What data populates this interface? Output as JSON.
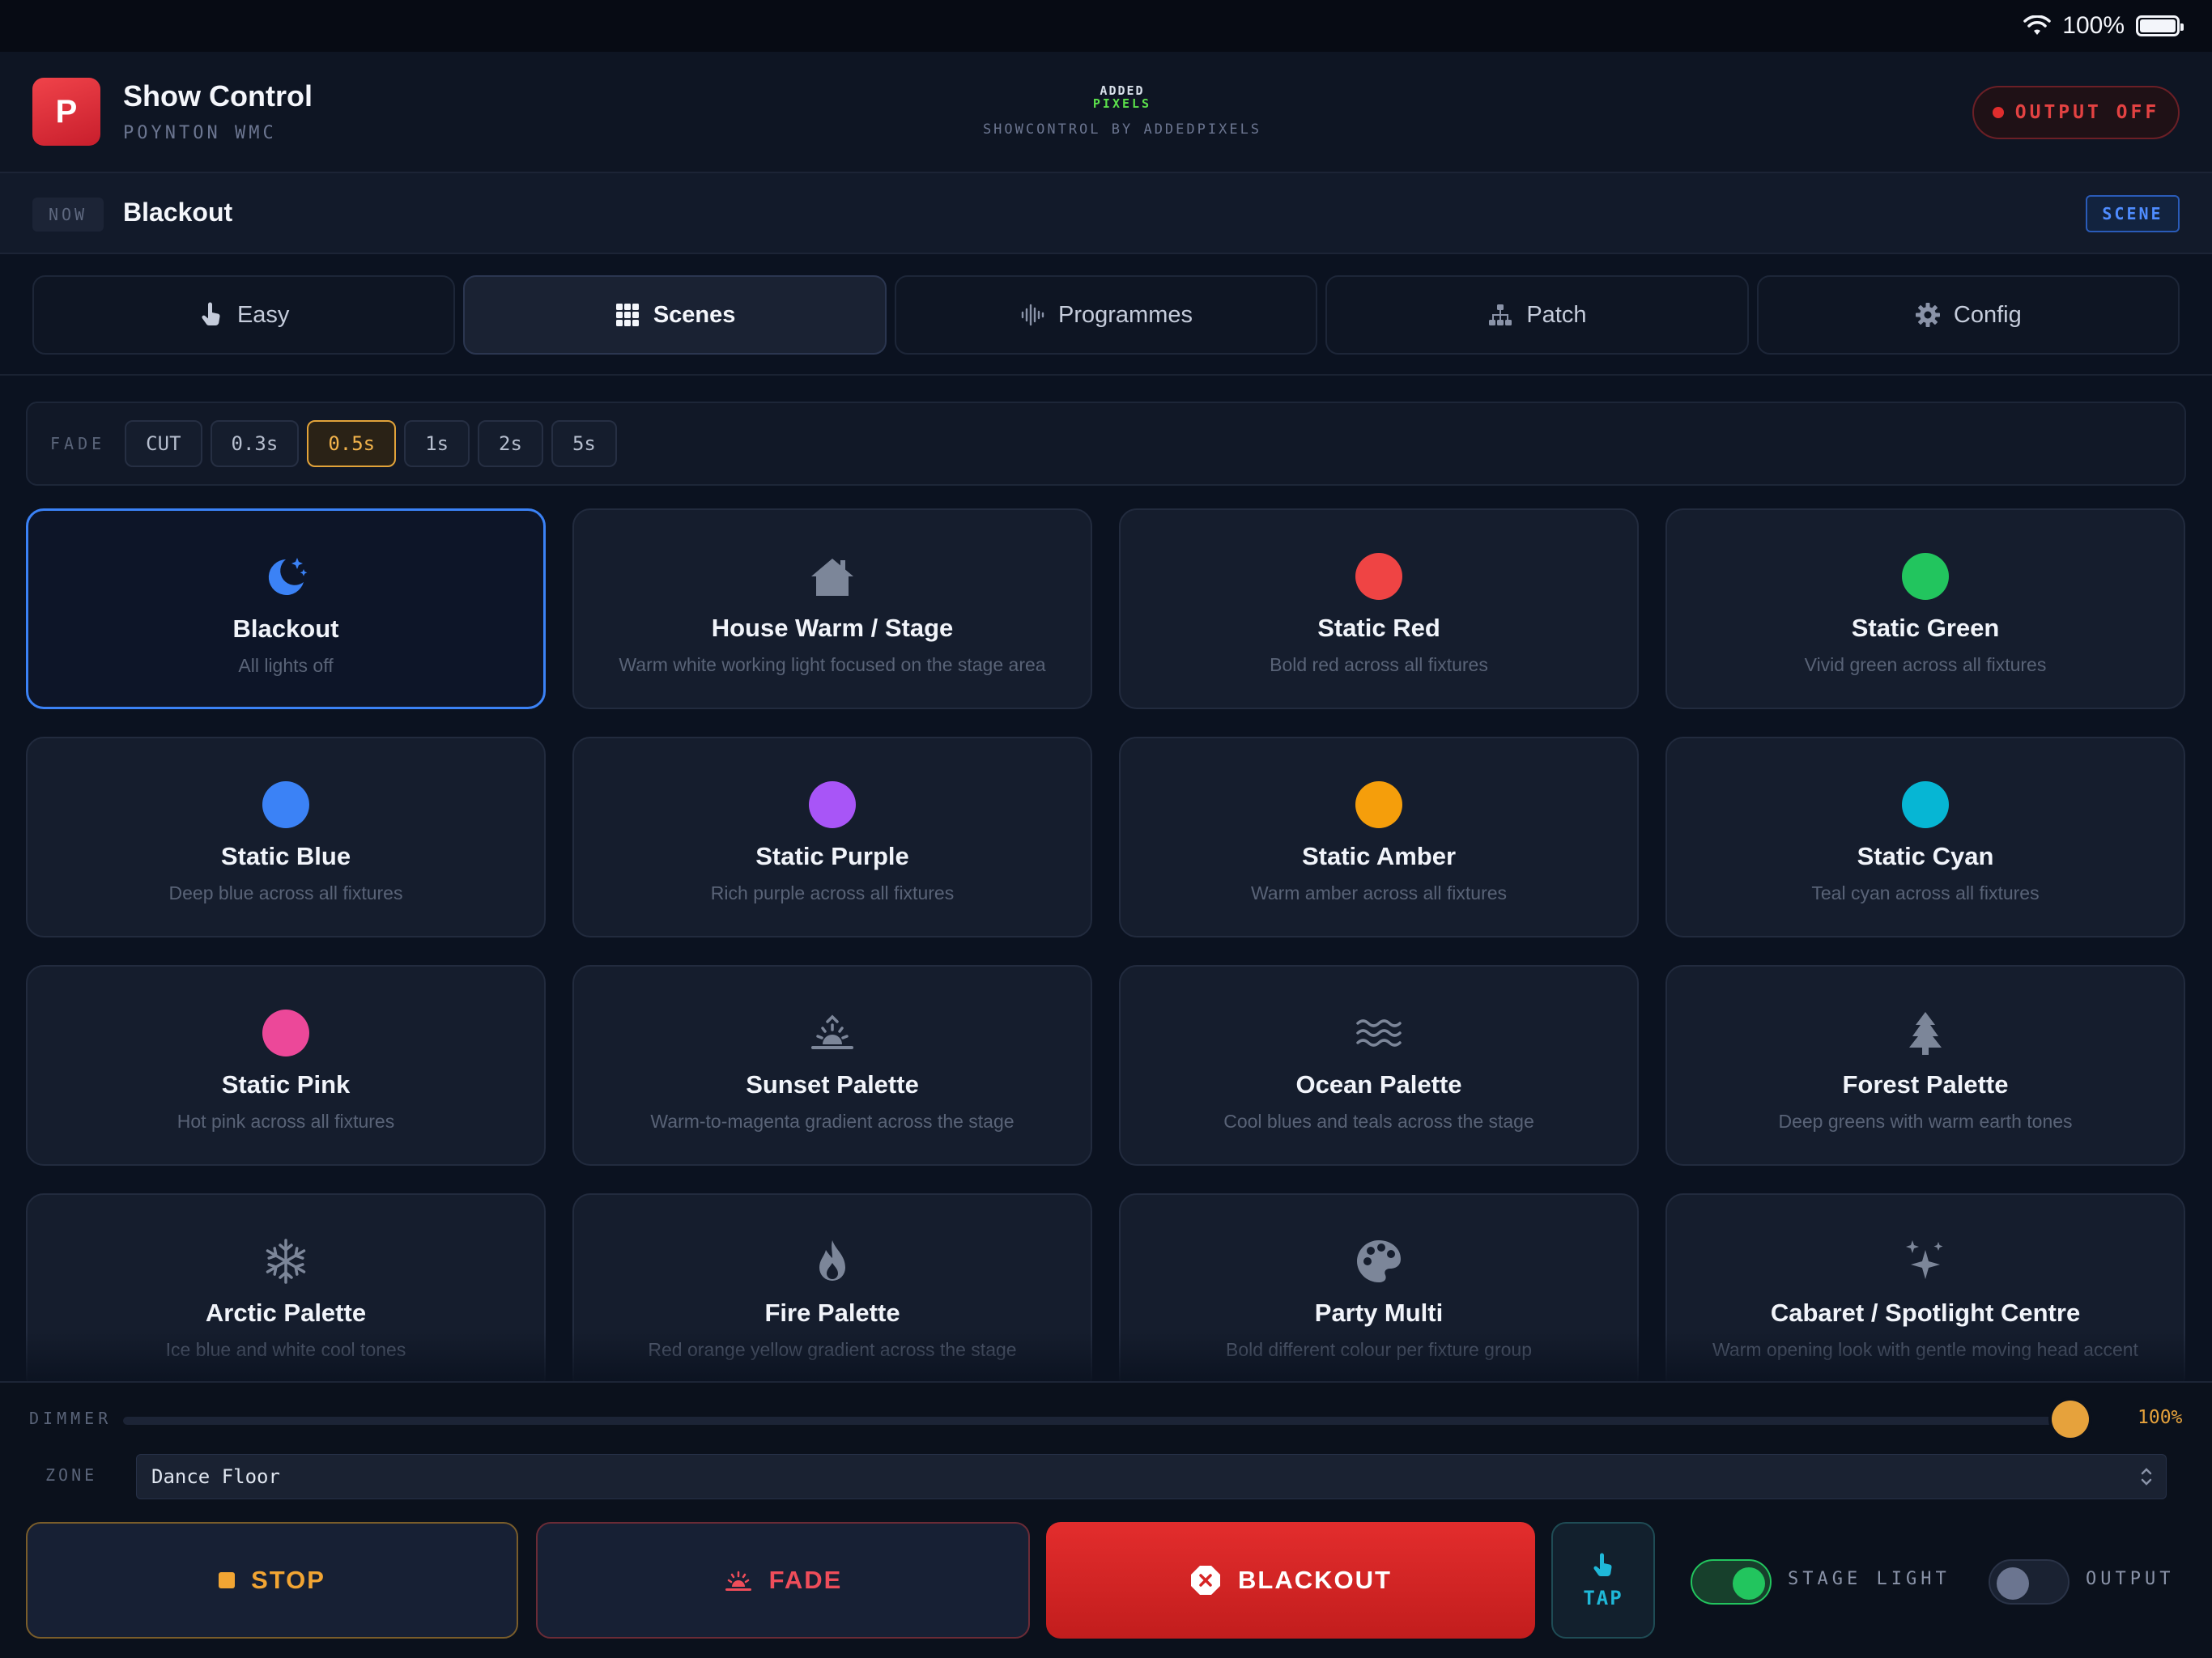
{
  "status_bar": {
    "battery": "100%"
  },
  "header": {
    "logo_letter": "P",
    "title": "Show Control",
    "subtitle": "POYNTON WMC",
    "brand_top": "ADDED",
    "brand_bottom": "PIXELS",
    "brand_tagline": "SHOWCONTROL BY ADDEDPIXELS",
    "output_button": "OUTPUT OFF"
  },
  "now_bar": {
    "tag": "NOW",
    "current_scene": "Blackout",
    "mode_tag": "SCENE"
  },
  "tabs": [
    {
      "label": "Easy",
      "icon": "hand-pointer-icon"
    },
    {
      "label": "Scenes",
      "icon": "grid-icon",
      "active": true
    },
    {
      "label": "Programmes",
      "icon": "waveform-icon"
    },
    {
      "label": "Patch",
      "icon": "network-icon"
    },
    {
      "label": "Config",
      "icon": "gear-icon"
    }
  ],
  "fade": {
    "label": "FADE",
    "options": [
      "CUT",
      "0.3s",
      "0.5s",
      "1s",
      "2s",
      "5s"
    ],
    "selected": "0.5s"
  },
  "scenes": [
    {
      "name": "Blackout",
      "desc": "All lights off",
      "icon": "moon-stars-icon",
      "active": true
    },
    {
      "name": "House Warm / Stage",
      "desc": "Warm white working light focused on the stage area",
      "icon": "house-icon"
    },
    {
      "name": "Static Red",
      "desc": "Bold red across all fixtures",
      "color": "#ef4444"
    },
    {
      "name": "Static Green",
      "desc": "Vivid green across all fixtures",
      "color": "#22c55e"
    },
    {
      "name": "Static Blue",
      "desc": "Deep blue across all fixtures",
      "color": "#3b82f6"
    },
    {
      "name": "Static Purple",
      "desc": "Rich purple across all fixtures",
      "color": "#a855f7"
    },
    {
      "name": "Static Amber",
      "desc": "Warm amber across all fixtures",
      "color": "#f59e0b"
    },
    {
      "name": "Static Cyan",
      "desc": "Teal cyan across all fixtures",
      "color": "#06b6d4"
    },
    {
      "name": "Static Pink",
      "desc": "Hot pink across all fixtures",
      "color": "#ec4899"
    },
    {
      "name": "Sunset Palette",
      "desc": "Warm-to-magenta gradient across the stage",
      "icon": "sunset-icon"
    },
    {
      "name": "Ocean Palette",
      "desc": "Cool blues and teals across the stage",
      "icon": "waves-icon"
    },
    {
      "name": "Forest Palette",
      "desc": "Deep greens with warm earth tones",
      "icon": "tree-icon"
    },
    {
      "name": "Arctic Palette",
      "desc": "Ice blue and white cool tones",
      "icon": "snowflake-icon"
    },
    {
      "name": "Fire Palette",
      "desc": "Red orange yellow gradient across the stage",
      "icon": "flame-icon"
    },
    {
      "name": "Party Multi",
      "desc": "Bold different colour per fixture group",
      "icon": "palette-icon"
    },
    {
      "name": "Cabaret / Spotlight Centre",
      "desc": "Warm opening look with gentle moving head accent",
      "icon": "sparkles-icon"
    }
  ],
  "dimmer": {
    "label": "DIMMER",
    "value_text": "100%",
    "level": 1.0
  },
  "zone": {
    "label": "ZONE",
    "value": "Dance Floor"
  },
  "controls": {
    "stop": "STOP",
    "fade": "FADE",
    "blackout": "BLACKOUT",
    "tap": "TAP",
    "stage_light": {
      "label": "STAGE LIGHT",
      "on": true
    },
    "output": {
      "label": "OUTPUT",
      "on": false
    }
  },
  "colors": {
    "accent": "#3b82f6",
    "amber": "#e6a23c",
    "danger": "#e32d2d",
    "success": "#22c55e"
  }
}
